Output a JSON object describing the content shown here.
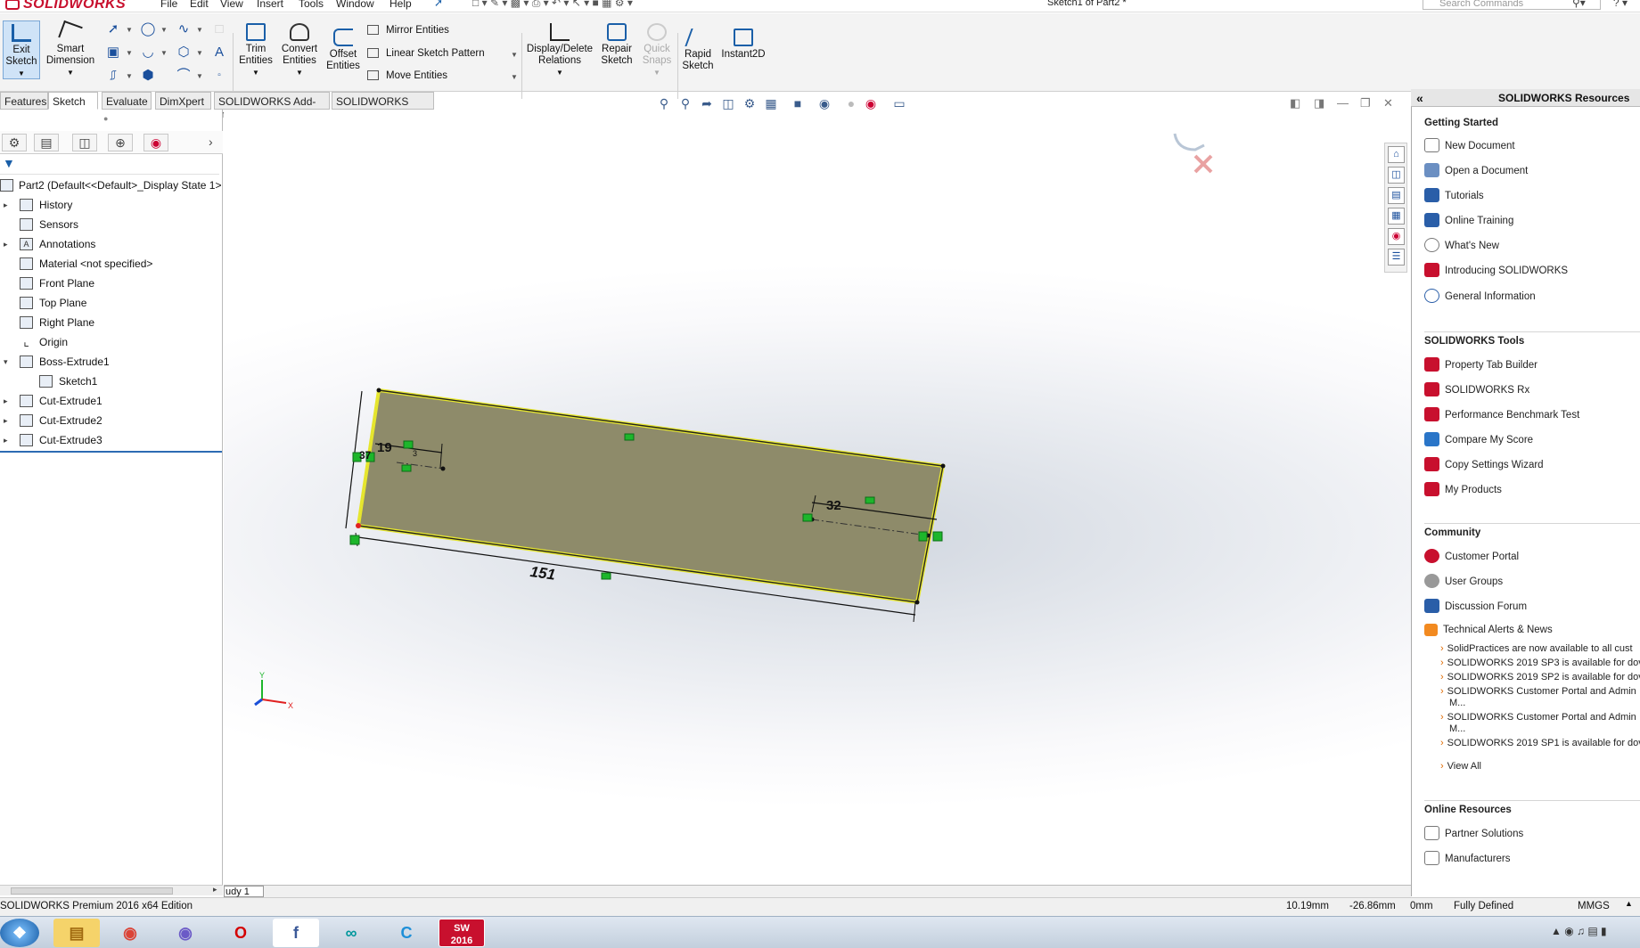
{
  "app": {
    "brand": "SOLIDWORKS",
    "document_title": "Sketch1 of Part2 *",
    "search_placeholder": "Search Commands"
  },
  "menu": [
    "File",
    "Edit",
    "View",
    "Insert",
    "Tools",
    "Window",
    "Help"
  ],
  "command_manager": {
    "exit_sketch": [
      "Exit",
      "Sketch"
    ],
    "smart_dimension": [
      "Smart",
      "Dimension"
    ],
    "trim_entities": [
      "Trim",
      "Entities"
    ],
    "convert_entities": [
      "Convert",
      "Entities"
    ],
    "offset_entities": [
      "Offset",
      "Entities"
    ],
    "mirror_entities": "Mirror Entities",
    "linear_sketch_pattern": "Linear Sketch Pattern",
    "move_entities": "Move Entities",
    "display_delete_relations": [
      "Display/Delete",
      "Relations"
    ],
    "repair_sketch": [
      "Repair",
      "Sketch"
    ],
    "quick_snaps": [
      "Quick",
      "Snaps"
    ],
    "rapid_sketch": [
      "Rapid",
      "Sketch"
    ],
    "instant2d": "Instant2D"
  },
  "tabs": [
    "Features",
    "Sketch",
    "Evaluate",
    "DimXpert",
    "SOLIDWORKS Add-Ins",
    "SOLIDWORKS MBD"
  ],
  "active_tab": "Sketch",
  "feature_tree": {
    "root": "Part2  (Default<<Default>_Display State 1>",
    "items": [
      "History",
      "Sensors",
      "Annotations",
      "Material <not specified>",
      "Front Plane",
      "Top Plane",
      "Right Plane",
      "Origin",
      "Boss-Extrude1",
      "Sketch1",
      "Cut-Extrude1",
      "Cut-Extrude2",
      "Cut-Extrude3"
    ]
  },
  "sketch": {
    "dim_length": "151",
    "dim_left": "19",
    "dim_right": "32",
    "dim_height": "37",
    "dim_small": "3"
  },
  "triad": {
    "x": "X",
    "y": "Y"
  },
  "bottom_tab": "udy 1",
  "resources": {
    "title": "SOLIDWORKS Resources",
    "getting_started_title": "Getting Started",
    "getting_started": [
      "New Document",
      "Open a Document",
      "Tutorials",
      "Online Training",
      "What's New",
      "Introducing SOLIDWORKS",
      "General Information"
    ],
    "tools_title": "SOLIDWORKS Tools",
    "tools": [
      "Property Tab Builder",
      "SOLIDWORKS Rx",
      "Performance Benchmark Test",
      "Compare My Score",
      "Copy Settings Wizard",
      "My Products"
    ],
    "community_title": "Community",
    "community": [
      "Customer Portal",
      "User Groups",
      "Discussion Forum",
      "Technical Alerts & News"
    ],
    "news": [
      "SolidPractices are now available to all cust",
      "SOLIDWORKS 2019 SP3 is available for dov",
      "SOLIDWORKS 2019 SP2 is available for dov",
      "SOLIDWORKS Customer Portal and Admin",
      "M...",
      "SOLIDWORKS Customer Portal and Admin",
      "M...",
      "SOLIDWORKS 2019 SP1 is available for dov"
    ],
    "view_all": "View All",
    "online_title": "Online Resources",
    "online": [
      "Partner Solutions",
      "Manufacturers"
    ]
  },
  "status": {
    "edition": "SOLIDWORKS Premium 2016 x64 Edition",
    "x": "10.19mm",
    "y": "-26.86mm",
    "z": "0mm",
    "state": "Fully Defined",
    "units": "MMGS"
  },
  "taskbar": {
    "sw_badge": "2016"
  },
  "colors": {
    "sketch_fill": "#8e8b6a",
    "edge": "#e6e62e",
    "relation": "#1db62b",
    "accent": "#1a5fa8"
  }
}
